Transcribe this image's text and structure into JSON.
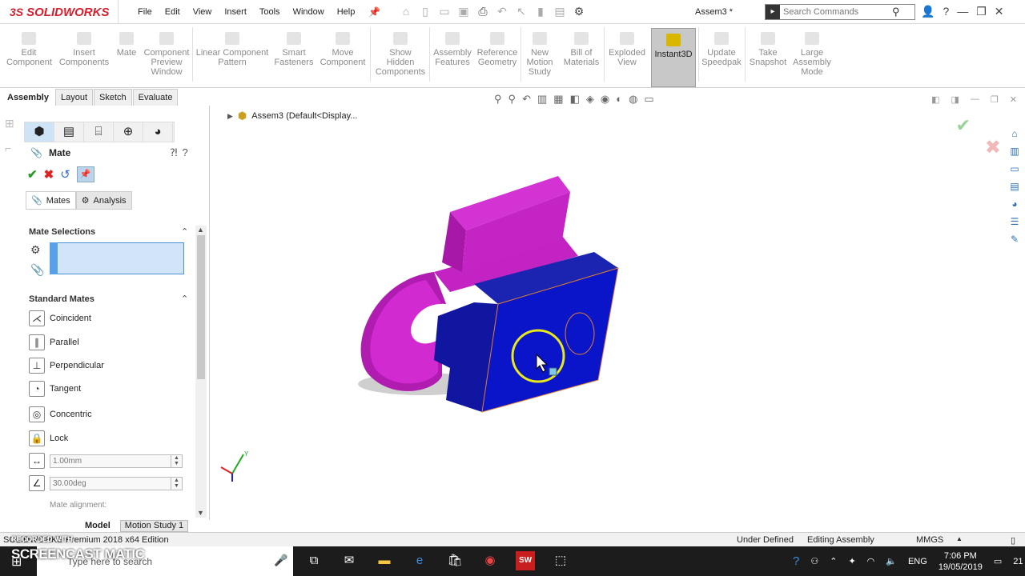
{
  "app": {
    "brand": "SOLIDWORKS",
    "brand_mark": "3S",
    "doc_title": "Assem3 *"
  },
  "menu": [
    "File",
    "Edit",
    "View",
    "Insert",
    "Tools",
    "Window",
    "Help"
  ],
  "search": {
    "placeholder": "Search Commands"
  },
  "ribbon": [
    {
      "label": "Edit\nComponent"
    },
    {
      "label": "Insert\nComponents"
    },
    {
      "label": "Mate"
    },
    {
      "label": "Component\nPreview\nWindow"
    },
    {
      "label": "Linear Component\nPattern"
    },
    {
      "label": "Smart\nFasteners"
    },
    {
      "label": "Move\nComponent"
    },
    {
      "label": "Show\nHidden\nComponents"
    },
    {
      "label": "Assembly\nFeatures"
    },
    {
      "label": "Reference\nGeometry"
    },
    {
      "label": "New\nMotion\nStudy"
    },
    {
      "label": "Bill of\nMaterials"
    },
    {
      "label": "Exploded\nView"
    },
    {
      "label": "Instant3D"
    },
    {
      "label": "Update\nSpeedpak"
    },
    {
      "label": "Take\nSnapshot"
    },
    {
      "label": "Large\nAssembly\nMode"
    }
  ],
  "cmd_tabs": [
    "Assembly",
    "Layout",
    "Sketch",
    "Evaluate"
  ],
  "property_manager": {
    "title": "Mate",
    "subtabs": [
      "Mates",
      "Analysis"
    ],
    "sections": {
      "selections": "Mate Selections",
      "standard": "Standard Mates"
    },
    "standard_mates": [
      "Coincident",
      "Parallel",
      "Perpendicular",
      "Tangent",
      "Concentric",
      "Lock"
    ],
    "distance_value": "1.00mm",
    "angle_value": "30.00deg",
    "mate_alignment": "Mate alignment:"
  },
  "viewport": {
    "tree_root": "Assem3  (Default<Display..."
  },
  "bottom_tabs": [
    "Model",
    "Motion Study 1"
  ],
  "status": {
    "edition": "SOLIDWORKS Premium 2018 x64 Edition",
    "state": "Under Defined",
    "mode": "Editing Assembly",
    "units": "MMGS"
  },
  "taskbar": {
    "search_placeholder": "Type here to search",
    "lang": "ENG",
    "time": "7:06 PM",
    "date": "19/05/2019",
    "notif": "21"
  },
  "watermark": {
    "text": "SCREENCAST  MATIC",
    "recorded": "RECORDED WITH"
  }
}
